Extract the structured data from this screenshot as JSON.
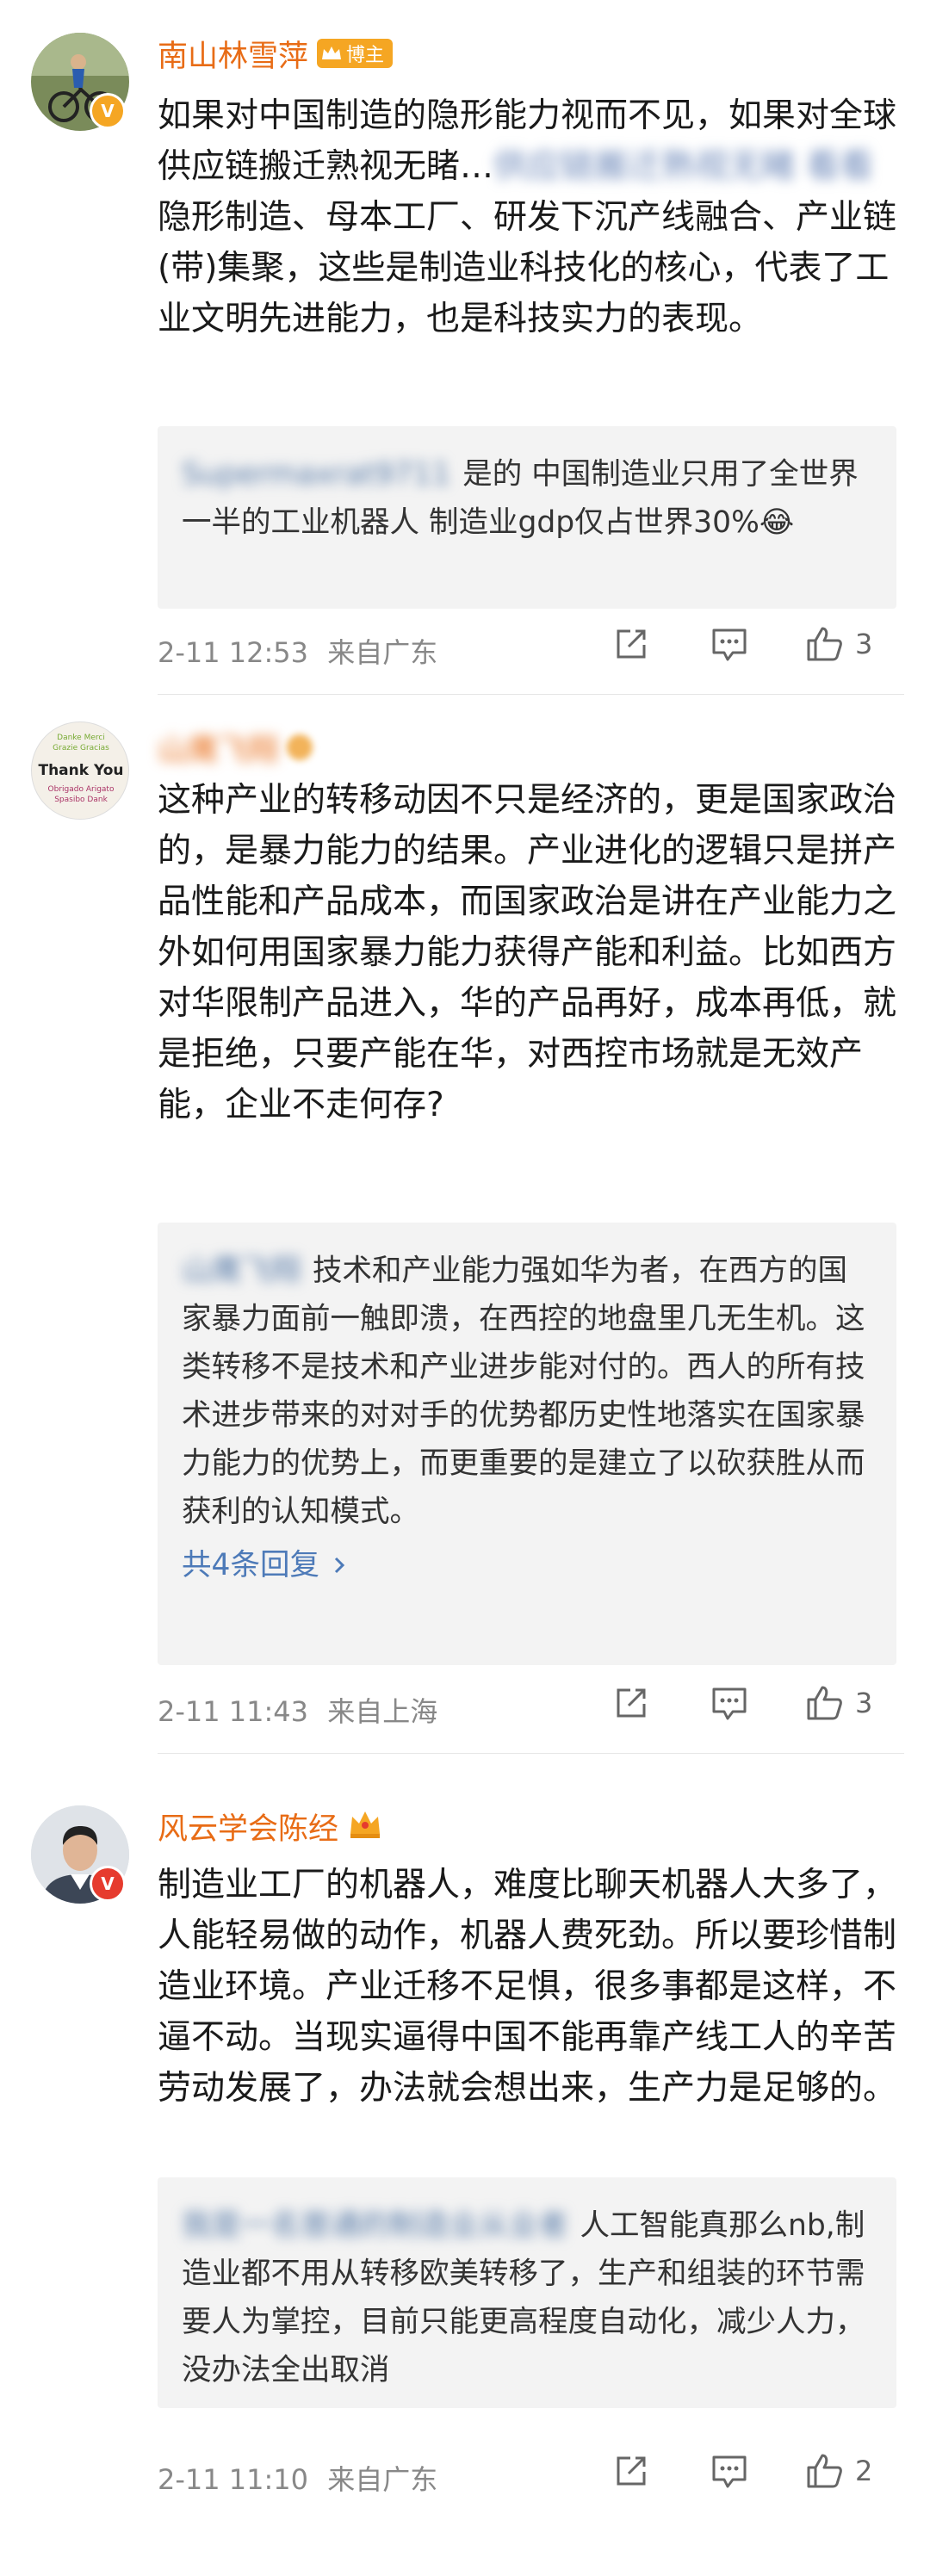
{
  "comments": [
    {
      "username": "南山林雪萍",
      "badge_label": "博主",
      "text_main": "如果对中国制造的隐形能力视而不见，如果对全球供应链搬迁熟视无睹…",
      "text_hidden": "供应链搬迁熟视无睹 看看",
      "text_rest": "隐形制造、母本工厂、研发下沉产线融合、产业链(带)集聚，这些是制造业科技化的核心，代表了工业文明先进能力，也是科技实力的表现。",
      "reply_user": "Supermaxrat9711",
      "reply_text": "是的 中国制造业只用了全世界一半的工业机器人 制造业gdp仅占世界30%",
      "reply_emoji": "😂",
      "time": "2-11 12:53",
      "location": "来自广东",
      "likes": "3"
    },
    {
      "username": "山鹰飞翔",
      "avatar_text": "Thank You",
      "text": "这种产业的转移动因不只是经济的，更是国家政治的，是暴力能力的结果。产业进化的逻辑只是拼产品性能和产品成本，而国家政治是讲在产业能力之外如何用国家暴力能力获得产能和利益。比如西方对华限制产品进入，华的产品再好，成本再低，就是拒绝，只要产能在华，对西控市场就是无效产能，企业不走何存?",
      "reply_user": "山鹰飞翔",
      "reply_text": "技术和产业能力强如华为者，在西方的国家暴力面前一触即溃，在西控的地盘里几无生机。这类转移不是技术和产业进步能对付的。西人的所有技术进步带来的对对手的优势都历史性地落实在国家暴力能力的优势上，而更重要的是建立了以砍获胜从而获利的认知模式。",
      "more_replies": "共4条回复",
      "time": "2-11 11:43",
      "location": "来自上海",
      "likes": "3"
    },
    {
      "username": "风云学会陈经",
      "text": "制造业工厂的机器人，难度比聊天机器人大多了，人能轻易做的动作，机器人费死劲。所以要珍惜制造业环境。产业迁移不足惧，很多事都是这样，不逼不动。当现实逼得中国不能再靠产线工人的辛苦劳动发展了，办法就会想出来，生产力是足够的。",
      "reply_user": "我是一名普通的制造业从业者",
      "reply_text": "人工智能真那么nb,制造业都不用从转移欧美转移了，生产和组装的环节需要人为掌控，目前只能更高程度自动化，减少人力，没办法全出取消",
      "time": "2-11 11:10",
      "location": "来自广东",
      "likes": "2"
    }
  ],
  "colors": {
    "username": "#e86c16",
    "reply_user": "#5a7daa",
    "badge_orange": "#f5a623",
    "badge_red": "#e63b2e",
    "reply_bg": "#f3f3f3"
  },
  "icons": [
    "share-icon",
    "comment-icon",
    "like-icon",
    "crown-icon",
    "verified-icon"
  ]
}
